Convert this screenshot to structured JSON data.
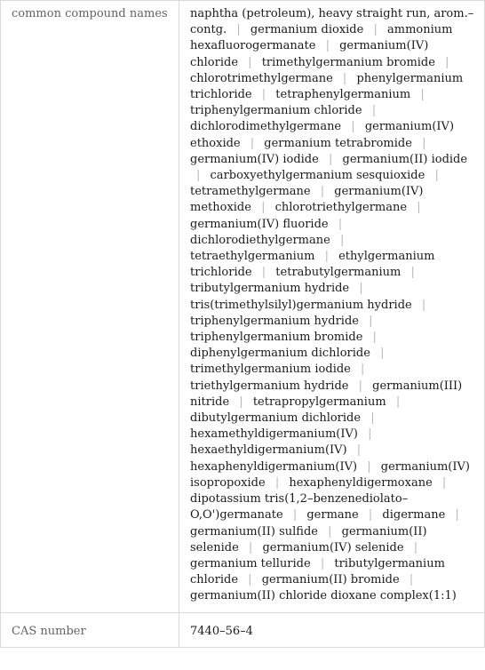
{
  "rows": [
    {
      "label": "common compound names",
      "names": [
        "naphtha (petroleum), heavy straight run, arom.–contg.",
        "germanium dioxide",
        "ammonium hexafluorogermanate",
        "germanium(IV) chloride",
        "trimethylgermanium bromide",
        "chlorotrimethylgermane",
        "phenylgermanium trichloride",
        "tetraphenylgermanium",
        "triphenylgermanium chloride",
        "dichlorodimethylgermane",
        "germanium(IV) ethoxide",
        "germanium tetrabromide",
        "germanium(IV) iodide",
        "germanium(II) iodide",
        "carboxyethylgermanium sesquioxide",
        "tetramethylgermane",
        "germanium(IV) methoxide",
        "chlorotriethylgermane",
        "germanium(IV) fluoride",
        "dichlorodiethylgermane",
        "tetraethylgermanium",
        "ethylgermanium trichloride",
        "tetrabutylgermanium",
        "tributylgermanium hydride",
        "tris(trimethylsilyl)germanium hydride",
        "triphenylgermanium hydride",
        "triphenylgermanium bromide",
        "diphenylgermanium dichloride",
        "trimethylgermanium iodide",
        "triethylgermanium hydride",
        "germanium(III) nitride",
        "tetrapropylgermanium",
        "dibutylgermanium dichloride",
        "hexamethyldigermanium(IV)",
        "hexaethyldigermanium(IV)",
        "hexaphenyldigermanium(IV)",
        "germanium(IV) isopropoxide",
        "hexaphenyldigermoxane",
        "dipotassium tris(1,2–benzenediolato–O,O')germanate",
        "germane",
        "digermane",
        "germanium(II) sulfide",
        "germanium(II) selenide",
        "germanium(IV) selenide",
        "germanium telluride",
        "tributylgermanium chloride",
        "germanium(II) bromide",
        "germanium(II) chloride dioxane complex(1:1)"
      ],
      "separator": "|"
    },
    {
      "label": "CAS number",
      "value": "7440–56–4"
    }
  ]
}
